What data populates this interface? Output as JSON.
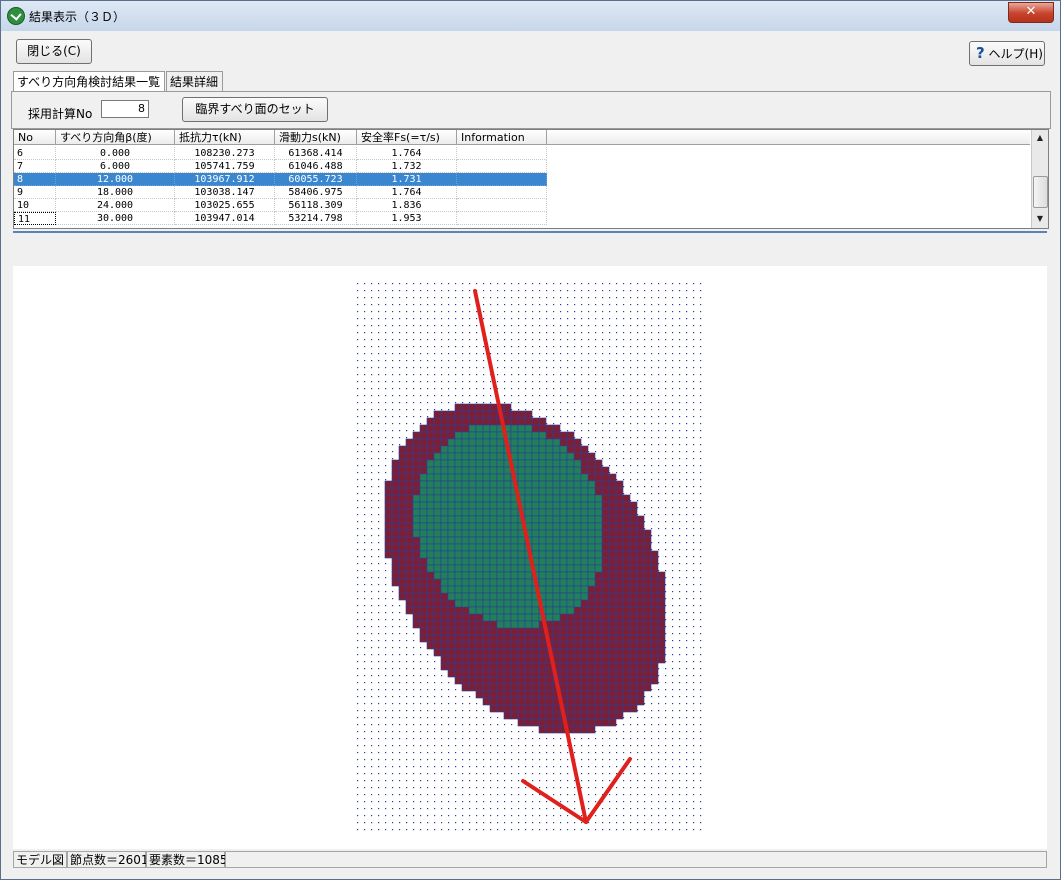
{
  "window": {
    "title": "結果表示（３Ｄ）",
    "close_glyph": "✕"
  },
  "toolbar": {
    "close_label": "閉じる(C)",
    "help_icon": "?",
    "help_label": "ヘルプ(H)"
  },
  "tabs": [
    {
      "label": "すべり方向角検討結果一覧",
      "active": true
    },
    {
      "label": "結果詳細",
      "active": false
    }
  ],
  "controls": {
    "calc_no_label": "採用計算No",
    "calc_no_value": "8",
    "set_critical_label": "臨界すべり面のセット"
  },
  "table": {
    "headers": [
      "No",
      "すべり方向角β(度)",
      "抵抗力τ(kN)",
      "滑動力s(kN)",
      "安全率Fs(=τ/s)",
      "Information"
    ],
    "rows": [
      [
        "6",
        "0.000",
        "108230.273",
        "61368.414",
        "1.764",
        ""
      ],
      [
        "7",
        "6.000",
        "105741.759",
        "61046.488",
        "1.732",
        ""
      ],
      [
        "8",
        "12.000",
        "103967.912",
        "60055.723",
        "1.731",
        ""
      ],
      [
        "9",
        "18.000",
        "103038.147",
        "58406.975",
        "1.764",
        ""
      ],
      [
        "10",
        "24.000",
        "103025.655",
        "56118.309",
        "1.836",
        ""
      ],
      [
        "11",
        "30.000",
        "103947.014",
        "53214.798",
        "1.953",
        ""
      ]
    ],
    "selected_row": 2
  },
  "status": {
    "view_label": "モデル図",
    "nodes_label": "節点数＝2601",
    "elements_label": "要素数＝1085"
  },
  "colors": {
    "outer_zone": "#7c1f35",
    "inner_zone": "#21805a",
    "mesh_lines": "#2a3c9a",
    "node_dots": "#2a3c9a",
    "arrow": "#e0201c",
    "selection": "#3a87d0"
  }
}
